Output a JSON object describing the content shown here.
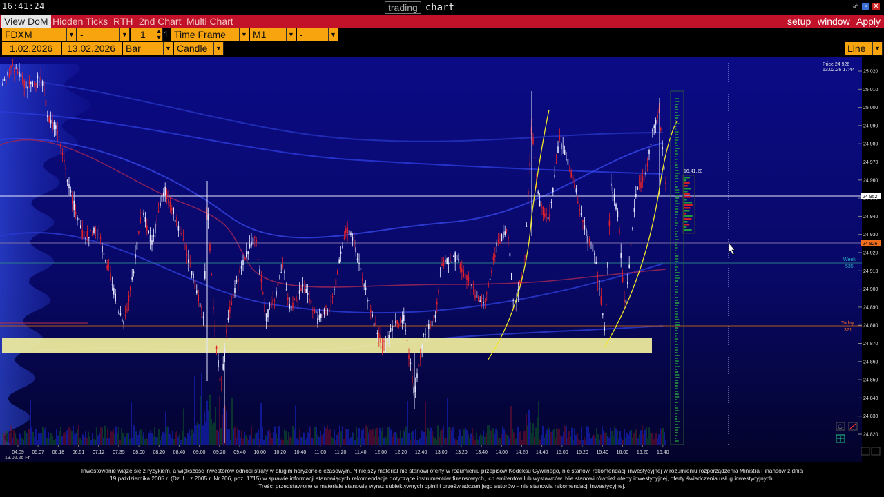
{
  "clock": "16:41:24",
  "title": {
    "left": "trading",
    "right": "chart"
  },
  "window_icons": [
    "minimize-icon",
    "restore-icon",
    "close-icon"
  ],
  "menu": {
    "tabs": [
      "View DoM",
      "Hidden Ticks",
      "RTH",
      "2nd Chart",
      "Multi Chart"
    ],
    "active_tab": "View DoM",
    "right": [
      "setup",
      "window",
      "Apply"
    ]
  },
  "controls": {
    "symbol": "FDXM",
    "dash1": "-",
    "qty": "1",
    "qty_suffix": "1",
    "timeframe_label": "Time Frame",
    "interval": "M1",
    "dash2": "-",
    "date_from": "1.02.2026",
    "date_to": "13.02.2026",
    "bar_type": "Bar",
    "style": "Candle",
    "line_mode": "Line"
  },
  "price_axis": [
    "25 020",
    "25 010",
    "25 000",
    "24 990",
    "24 980",
    "24 970",
    "24 960",
    "24 950",
    "24 940",
    "24 930",
    "24 920",
    "24 910",
    "24 900",
    "24 890",
    "24 880",
    "24 870",
    "24 860",
    "24 850",
    "24 840",
    "24 830",
    "24 820"
  ],
  "time_axis": [
    "04:09",
    "05:07",
    "06:18",
    "06:51",
    "07:12",
    "07:35",
    "08:00",
    "08:20",
    "08:40",
    "09:00",
    "09:20",
    "09:40",
    "10:00",
    "10:20",
    "10:40",
    "11:00",
    "11:20",
    "11:40",
    "12:00",
    "12:20",
    "12:40",
    "13:00",
    "13:20",
    "13:40",
    "14:00",
    "14:20",
    "14:40",
    "15:00",
    "15:20",
    "15:40",
    "16:00",
    "16:20",
    "16:40"
  ],
  "date_label": "13.02.26 Fri",
  "info": {
    "price": "Price 24 926",
    "datetime": "13.02.26 17:44"
  },
  "labels": {
    "current_price": "24 952",
    "last_price": "24 926",
    "week": "Week",
    "week_value": "535",
    "today": "Today",
    "today_value": "321",
    "time_marker": "16:41:20"
  },
  "colors": {
    "accent": "#f7a40e",
    "menubar": "#c2122a",
    "chart_bg": "#0a0a7a",
    "support_zone": "#f1ee9e",
    "bull": "#e6e6ff",
    "bear": "#e0202c"
  },
  "disclaimer": [
    "Inwestowanie  wiąże  się  z ryzykiem, a większość inwestorów odnosi straty w długim horyzoncie czasowym. Niniejszy materiał nie stanowi oferty w rozumieniu przepisów Kodeksu Cywilnego,  nie stanowi rekomendacji inwestycyjnej w rozumieniu rozporządzenia Ministra Finansów z dnia",
    "19 października 2005 r. (Dz. U. z 2005 r. Nr 206, poz. 1715) w sprawie informacji stanowiących rekomendacje dotyczące instrumentów finansowych,  ich emitentów lub wystawców. Nie stanowi również oferty inwestycyjnej, oferty świadczenia usług inwestycyjnych.",
    "Treści przedstawione w materiale stanowią wyraz  subiektywnych opinii i przeświadczeń jego autorów – nie stanowią rekomendacji inwestycyjnej."
  ]
}
